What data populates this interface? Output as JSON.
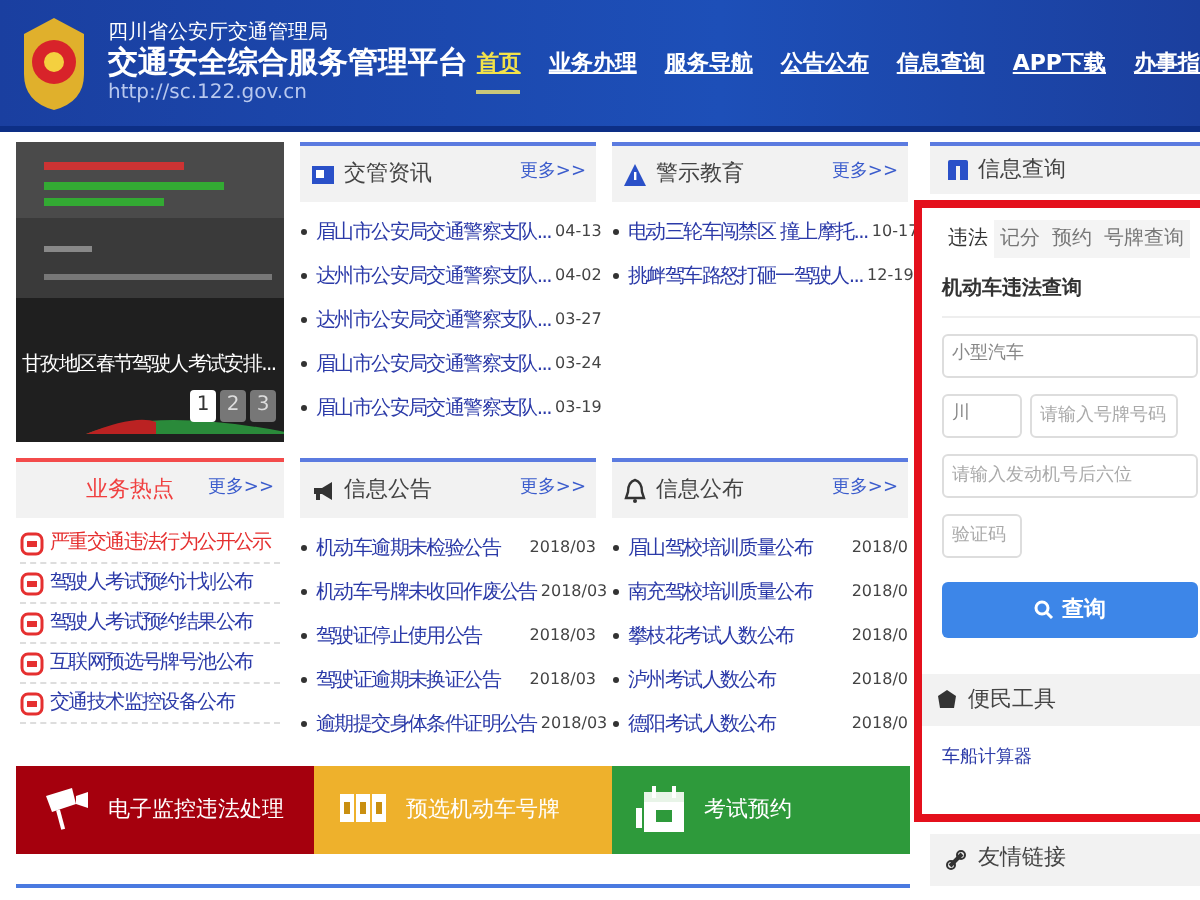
{
  "header": {
    "org": "四川省公安厅交通管理局",
    "title": "交通安全综合服务管理平台",
    "url": "http://sc.122.gov.cn",
    "nav": [
      {
        "label": "首页",
        "selected": true
      },
      {
        "label": "业务办理",
        "selected": false
      },
      {
        "label": "服务导航",
        "selected": false
      },
      {
        "label": "公告公布",
        "selected": false
      },
      {
        "label": "信息查询",
        "selected": false
      },
      {
        "label": "APP下载",
        "selected": false
      },
      {
        "label": "办事指",
        "selected": false
      }
    ]
  },
  "carousel": {
    "caption": "甘孜地区春节驾驶人考试安排...",
    "pages": [
      {
        "label": "1",
        "selected": true
      },
      {
        "label": "2",
        "selected": false
      },
      {
        "label": "3",
        "selected": false
      }
    ]
  },
  "news_panels": [
    {
      "title": "交管资讯",
      "more": "更多>>",
      "items": [
        {
          "text": "眉山市公安局交通警察支队...",
          "date": "04-13"
        },
        {
          "text": "达州市公安局交通警察支队...",
          "date": "04-02"
        },
        {
          "text": "达州市公安局交通警察支队...",
          "date": "03-27"
        },
        {
          "text": "眉山市公安局交通警察支队...",
          "date": "03-24"
        },
        {
          "text": "眉山市公安局交通警察支队...",
          "date": "03-19"
        }
      ]
    },
    {
      "title": "警示教育",
      "more": "更多>>",
      "items": [
        {
          "text": "电动三轮车闯禁区 撞上摩托...",
          "date": "10-17"
        },
        {
          "text": "挑衅驾车路怒打砸一驾驶人...",
          "date": "12-19"
        }
      ]
    },
    {
      "title": "信息公告",
      "more": "更多>>",
      "items": [
        {
          "text": "机动车逾期未检验公告",
          "date": "2018/03"
        },
        {
          "text": "机动车号牌未收回作废公告",
          "date": "2018/03"
        },
        {
          "text": "驾驶证停止使用公告",
          "date": "2018/03"
        },
        {
          "text": "驾驶证逾期未换证公告",
          "date": "2018/03"
        },
        {
          "text": "逾期提交身体条件证明公告",
          "date": "2018/03"
        }
      ]
    },
    {
      "title": "信息公布",
      "more": "更多>>",
      "items": [
        {
          "text": "眉山驾校培训质量公布",
          "date": "2018/0"
        },
        {
          "text": "南充驾校培训质量公布",
          "date": "2018/0"
        },
        {
          "text": "攀枝花考试人数公布",
          "date": "2018/0"
        },
        {
          "text": "泸州考试人数公布",
          "date": "2018/0"
        },
        {
          "text": "德阳考试人数公布",
          "date": "2018/0"
        }
      ]
    }
  ],
  "hot": {
    "title": "业务热点",
    "more": "更多>>",
    "items": [
      {
        "text": "严重交通违法行为公开公示",
        "highlighted": true
      },
      {
        "text": "驾驶人考试预约计划公布",
        "highlighted": false
      },
      {
        "text": "驾驶人考试预约结果公布",
        "highlighted": false
      },
      {
        "text": "互联网预选号牌号池公布",
        "highlighted": false
      },
      {
        "text": "交通技术监控设备公布",
        "highlighted": false
      }
    ]
  },
  "banners": [
    {
      "label": "电子监控违法处理",
      "color": "#a5000d"
    },
    {
      "label": "预选机动车号牌",
      "color": "#eeb12c"
    },
    {
      "label": "考试预约",
      "color": "#2e9a3b"
    }
  ],
  "query": {
    "title": "信息查询",
    "tabs": [
      {
        "label": "违法",
        "selected": true
      },
      {
        "label": "记分",
        "selected": false
      },
      {
        "label": "预约",
        "selected": false
      },
      {
        "label": "号牌查询",
        "selected": false
      }
    ],
    "form_title": "机动车违法查询",
    "vehicle_type": "小型汽车",
    "province": "川",
    "plate_placeholder": "请输入号牌号码",
    "engine_placeholder": "请输入发动机号后六位",
    "captcha_placeholder": "验证码",
    "button": "查询"
  },
  "tools": {
    "title": "便民工具",
    "items": [
      "车船计算器"
    ]
  },
  "links": {
    "title": "友情链接"
  }
}
